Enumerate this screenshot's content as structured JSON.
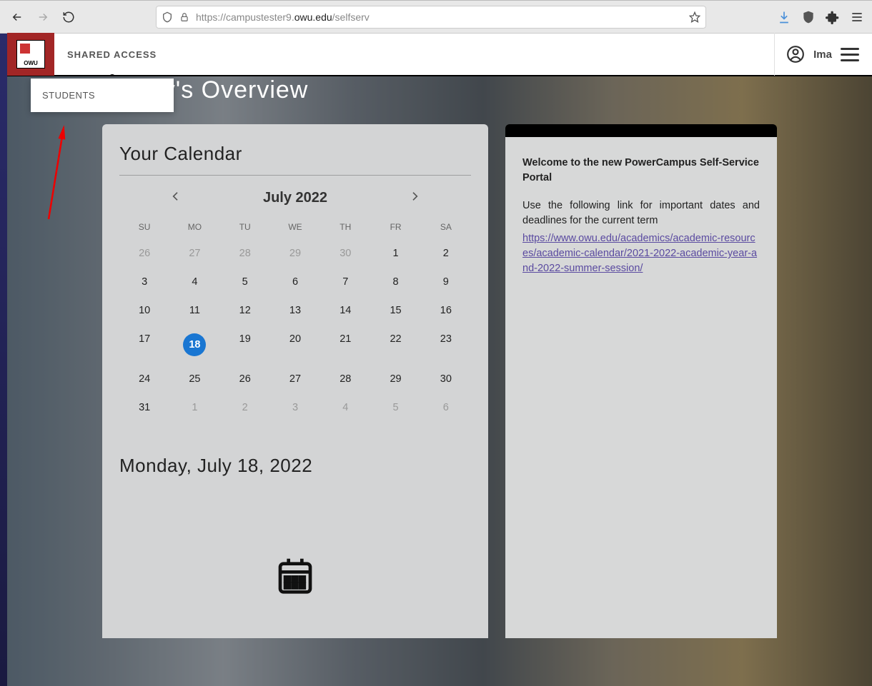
{
  "browser": {
    "url_pre": "https://campustester9.",
    "url_host": "owu.edu",
    "url_path": "/selfserv"
  },
  "header": {
    "logo_text": "OWU",
    "nav_shared_access": "SHARED ACCESS",
    "dropdown_students": "STUDENTS",
    "user_name": "Ima"
  },
  "page": {
    "title": "Today's Overview"
  },
  "calendar": {
    "heading": "Your Calendar",
    "month_label": "July 2022",
    "dow": [
      "SU",
      "MO",
      "TU",
      "WE",
      "TH",
      "FR",
      "SA"
    ],
    "weeks": [
      [
        {
          "n": "26",
          "other": true
        },
        {
          "n": "27",
          "other": true
        },
        {
          "n": "28",
          "other": true
        },
        {
          "n": "29",
          "other": true
        },
        {
          "n": "30",
          "other": true
        },
        {
          "n": "1"
        },
        {
          "n": "2"
        }
      ],
      [
        {
          "n": "3"
        },
        {
          "n": "4"
        },
        {
          "n": "5"
        },
        {
          "n": "6"
        },
        {
          "n": "7"
        },
        {
          "n": "8"
        },
        {
          "n": "9"
        }
      ],
      [
        {
          "n": "10"
        },
        {
          "n": "11"
        },
        {
          "n": "12"
        },
        {
          "n": "13"
        },
        {
          "n": "14"
        },
        {
          "n": "15"
        },
        {
          "n": "16"
        }
      ],
      [
        {
          "n": "17"
        },
        {
          "n": "18",
          "today": true
        },
        {
          "n": "19"
        },
        {
          "n": "20"
        },
        {
          "n": "21"
        },
        {
          "n": "22"
        },
        {
          "n": "23"
        }
      ],
      [
        {
          "n": "24"
        },
        {
          "n": "25"
        },
        {
          "n": "26"
        },
        {
          "n": "27"
        },
        {
          "n": "28"
        },
        {
          "n": "29"
        },
        {
          "n": "30"
        }
      ],
      [
        {
          "n": "31"
        },
        {
          "n": "1",
          "other": true
        },
        {
          "n": "2",
          "other": true
        },
        {
          "n": "3",
          "other": true
        },
        {
          "n": "4",
          "other": true
        },
        {
          "n": "5",
          "other": true
        },
        {
          "n": "6",
          "other": true
        }
      ]
    ],
    "selected_date_label": "Monday, July 18, 2022"
  },
  "side": {
    "welcome": "Welcome to the new PowerCampus Self-Service Portal",
    "desc": "Use the following link for important dates and deadlines for the current term",
    "link_text": "https://www.owu.edu/academics/academic-resources/academic-calendar/2021-2022-academic-year-and-2022-summer-session/"
  }
}
